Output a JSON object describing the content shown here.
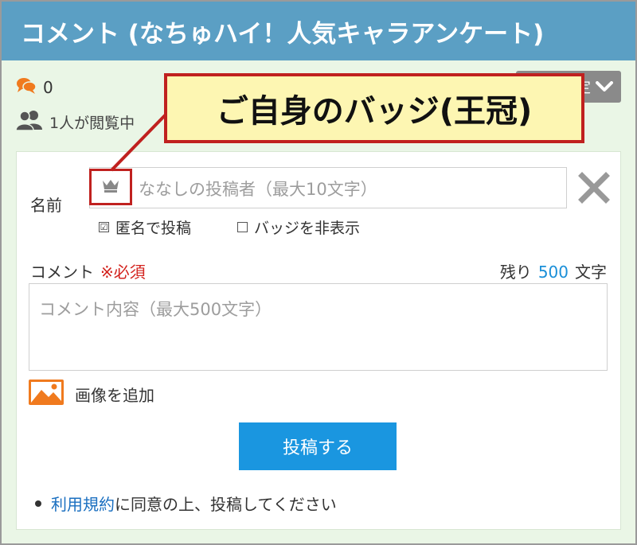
{
  "header": {
    "title": "コメント (なちゅハイ！人気キャラアンケート)"
  },
  "stats": {
    "comment_count": "0",
    "viewers": "1人が閲覧中"
  },
  "settings": {
    "label": "設定"
  },
  "form": {
    "name_label": "名前",
    "name_placeholder": "ななしの投稿者（最大10文字）",
    "anonymous_label": "匿名で投稿",
    "anonymous_checked": "☑",
    "hide_badge_label": "バッジを非表示",
    "comment_label": "コメント",
    "required_label": "※必須",
    "remaining_prefix": "残り",
    "remaining_count": "500",
    "remaining_suffix": "文字",
    "comment_placeholder": "コメント内容（最大500文字）",
    "add_image_label": "画像を追加",
    "submit_label": "投稿する",
    "terms_link": "利用規約",
    "terms_text": "に同意の上、投稿してください"
  },
  "callout": {
    "text": "ご自身のバッジ(王冠)"
  },
  "colors": {
    "header_bg": "#5b9fc4",
    "accent_blue": "#1a96e0",
    "required_red": "#d3221d",
    "callout_border": "#c0211f",
    "callout_bg": "#fdf6b2",
    "image_icon": "#f07a1e",
    "comment_icon": "#f07a1e"
  },
  "icons": {
    "comment": "speech-bubbles-icon",
    "viewers": "users-icon",
    "crown": "crown-icon",
    "close": "close-icon",
    "image": "image-icon",
    "chevron": "chevron-down-icon"
  }
}
